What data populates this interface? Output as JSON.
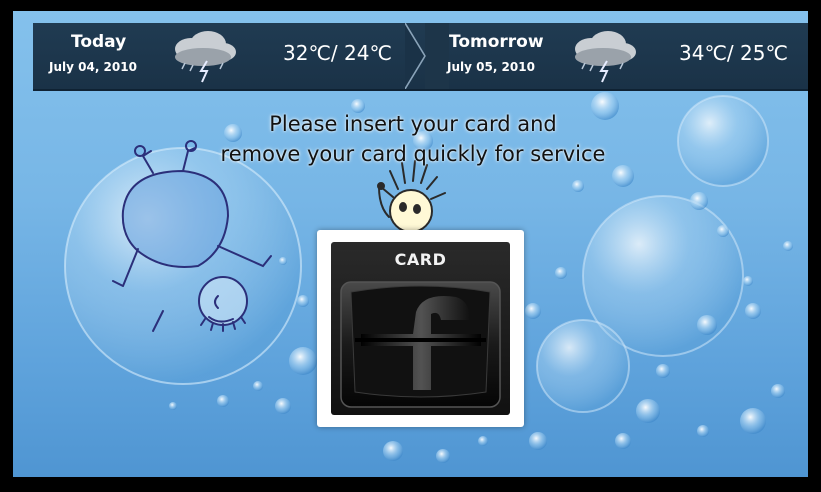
{
  "weather": {
    "today": {
      "label": "Today",
      "date": "July 04, 2010",
      "temps": "32℃/  24℃",
      "icon": "thunderstorm-icon"
    },
    "tomorrow": {
      "label": "Tomorrow",
      "date": "July 05, 2010",
      "temps": "34℃/  25℃",
      "icon": "thunderstorm-icon"
    }
  },
  "message": {
    "line1": "Please insert your card and",
    "line2": "remove your card quickly for service"
  },
  "card_reader": {
    "label": "CARD",
    "icon": "card-slot-icon"
  },
  "colors": {
    "weather_bar": "#1d3549",
    "screen_bg": "#7ab8e8",
    "text_dark": "#111111"
  }
}
